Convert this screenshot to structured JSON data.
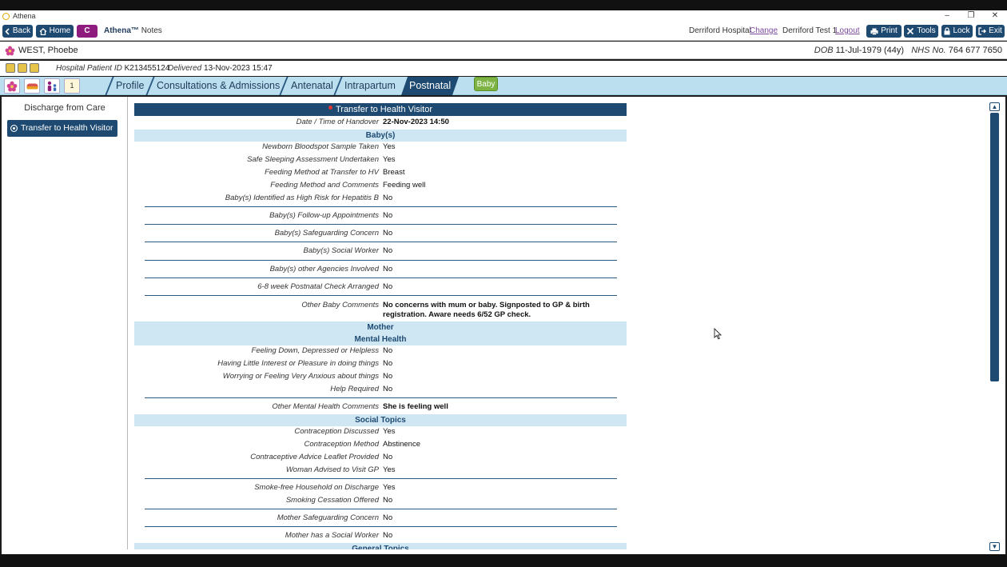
{
  "window": {
    "title": "Athena",
    "minimize": "–",
    "restore": "❐",
    "close": "✕"
  },
  "toolbar": {
    "back_label": "Back",
    "home_label": "Home",
    "c_label": "C",
    "brand": "Athena™",
    "module": "Notes",
    "hospital": "Derriford Hospital",
    "change_label": "Change",
    "user": "Derriford Test 1",
    "logout_label": "Logout",
    "print_label": "Print",
    "tools_label": "Tools",
    "lock_label": "Lock",
    "exit_label": "Exit"
  },
  "patient": {
    "name": "WEST, Phoebe",
    "dob_label": "DOB",
    "dob_value": "11-Jul-1979 (44y)",
    "nhs_label": "NHS No.",
    "nhs_value": "764 677 7650",
    "hospital_id_label": "Hospital Patient ID",
    "hospital_id_value": "K213455124",
    "delivered_label": "Delivered",
    "delivered_value": "13-Nov-2023 15:47"
  },
  "nav": {
    "tabs": [
      "Profile",
      "Consultations & Admissions",
      "Antenatal",
      "Intrapartum"
    ],
    "active_tab": "Postnatal",
    "baby_badge": "Baby",
    "calendar_badge": "1"
  },
  "sidebar": {
    "title": "Discharge from Care",
    "selected_item": "Transfer to Health Visitor"
  },
  "form": {
    "title": "Transfer to Health Visitor",
    "handover_label": "Date / Time of Handover",
    "handover_value": "22-Nov-2023 14:50",
    "baby_section": "Baby(s)",
    "baby_rows": [
      {
        "label": "Newborn Bloodspot Sample Taken",
        "value": "Yes"
      },
      {
        "label": "Safe Sleeping Assessment Undertaken",
        "value": "Yes"
      },
      {
        "label": "Feeding Method at Transfer to HV",
        "value": "Breast"
      },
      {
        "label": "Feeding Method and Comments",
        "value": "Feeding well"
      },
      {
        "label": "Baby(s) Identified as High Risk for Hepatitis B",
        "value": "No"
      },
      {
        "label": "Baby(s) Follow-up Appointments",
        "value": "No"
      },
      {
        "label": "Baby(s) Safeguarding Concern",
        "value": "No"
      },
      {
        "label": "Baby(s) Social Worker",
        "value": "No"
      },
      {
        "label": "Baby(s) other Agencies Involved",
        "value": "No"
      },
      {
        "label": "6-8 week Postnatal Check Arranged",
        "value": "No"
      },
      {
        "label": "Other Baby Comments",
        "value": "No concerns with mum or baby. Signposted to GP & birth registration. Aware needs 6/52 GP check."
      }
    ],
    "mother_section": "Mother",
    "mental_section": "Mental Health",
    "mental_rows": [
      {
        "label": "Feeling Down, Depressed or Helpless",
        "value": "No"
      },
      {
        "label": "Having Little Interest or Pleasure in doing things",
        "value": "No"
      },
      {
        "label": "Worrying or Feeling Very Anxious about things",
        "value": "No"
      },
      {
        "label": "Help Required",
        "value": "No"
      },
      {
        "label": "Other Mental Health Comments",
        "value": "She is feeling well"
      }
    ],
    "social_section": "Social Topics",
    "social_rows": [
      {
        "label": "Contraception Discussed",
        "value": "Yes"
      },
      {
        "label": "Contraception Method",
        "value": "Abstinence"
      },
      {
        "label": "Contraceptive Advice Leaflet Provided",
        "value": "No"
      },
      {
        "label": "Woman Advised to Visit GP",
        "value": "Yes"
      },
      {
        "label": "Smoke-free Household on Discharge",
        "value": "Yes"
      },
      {
        "label": "Smoking Cessation Offered",
        "value": "No"
      },
      {
        "label": "Mother Safeguarding Concern",
        "value": "No"
      },
      {
        "label": "Mother has a Social Worker",
        "value": "No"
      }
    ],
    "general_section": "General Topics"
  },
  "colors": {
    "accent": "#1e4a72",
    "nav_bg": "#bcdff0",
    "section_bg": "#cfe6f3",
    "baby_badge": "#7cb342",
    "c_button": "#8e1b7e"
  }
}
